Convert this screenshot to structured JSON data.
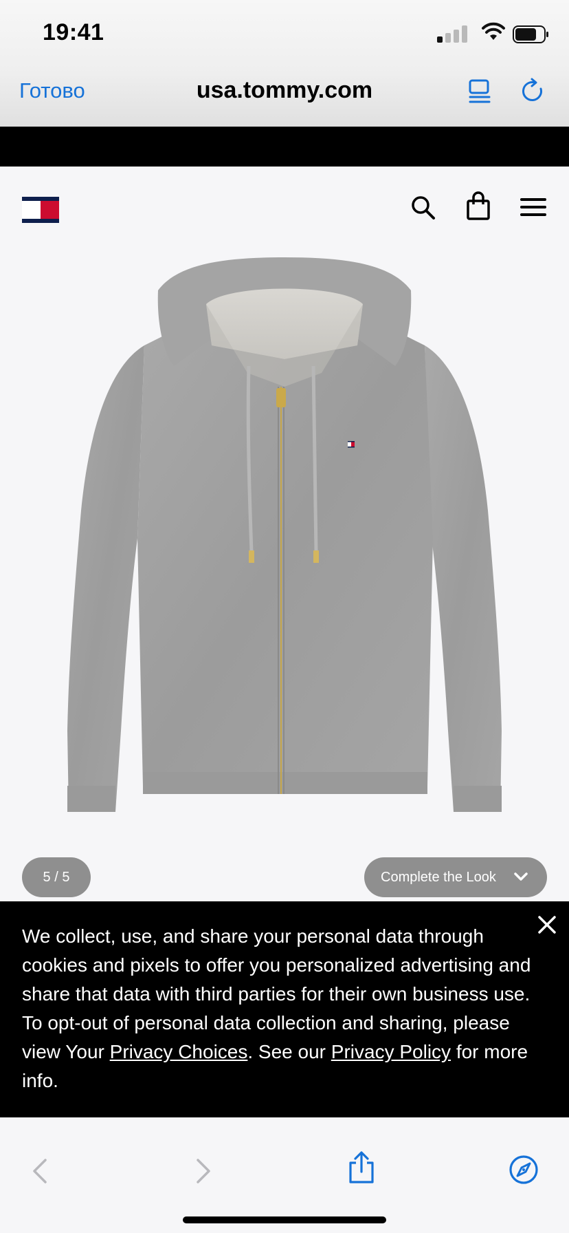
{
  "status_bar": {
    "time": "19:41",
    "signal_bars_active": 1,
    "signal_bars_total": 4,
    "battery_level": 0.7
  },
  "browser": {
    "done_label": "Готово",
    "url": "usa.tommy.com",
    "icons": [
      "reader-icon",
      "reload-icon"
    ],
    "accent_color": "#1672d8"
  },
  "site_header": {
    "logo": "tommy-hilfiger-flag-logo",
    "icons": [
      "search-icon",
      "bag-icon",
      "menu-icon"
    ]
  },
  "product": {
    "image_alt": "gray zip-up hoodie",
    "gallery_counter": "5 / 5",
    "complete_look_label": "Complete the Look"
  },
  "cookie_banner": {
    "text_part1": "We collect, use, and share your personal data through cookies and pixels to offer you personalized advertising and share that data with third parties for their own business use. To opt-out of personal data collection and sharing, please view Your ",
    "privacy_choices_link": "Privacy Choices",
    "text_part2": ". See our ",
    "privacy_policy_link": "Privacy Policy",
    "text_part3": " for more info."
  },
  "bottom_toolbar": {
    "icons": [
      "back-icon",
      "forward-icon",
      "share-icon",
      "compass-icon"
    ]
  },
  "colors": {
    "brand_navy": "#0e1f4d",
    "brand_red": "#cc0c2f",
    "ios_blue": "#1672d8"
  }
}
